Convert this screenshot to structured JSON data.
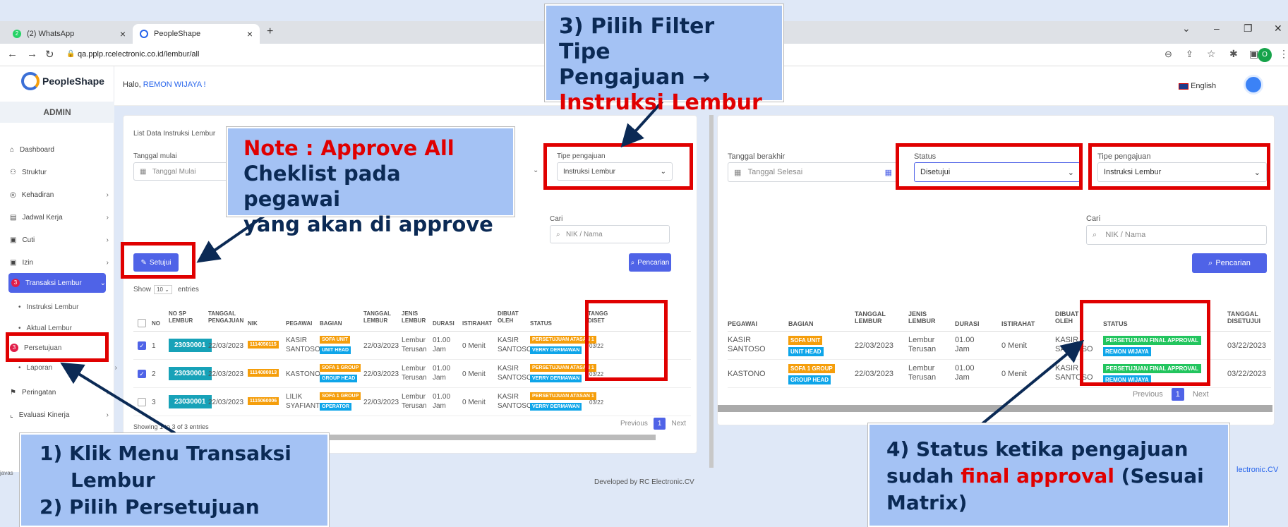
{
  "browser": {
    "tab1": "(2) WhatsApp",
    "tab2": "PeopleShape",
    "url": "qa.pplp.rcelectronic.co.id/lembur/all",
    "status_text": "javas"
  },
  "app": {
    "logo": "PeopleShape",
    "role": "ADMIN",
    "greeting_prefix": "Halo, ",
    "greeting_name": "REMON WIJAYA !",
    "language": "English",
    "footer": "Developed by RC Electronic.CV",
    "footer_right": "lectronic.CV"
  },
  "sidebar": {
    "items": [
      {
        "label": "Dashboard",
        "icon": "home-icon"
      },
      {
        "label": "Struktur",
        "icon": "org-icon"
      },
      {
        "label": "Kehadiran",
        "icon": "fingerprint-icon"
      },
      {
        "label": "Jadwal Kerja",
        "icon": "calendar-icon"
      },
      {
        "label": "Cuti",
        "icon": "clipboard-icon"
      },
      {
        "label": "Izin",
        "icon": "clipboard-icon"
      },
      {
        "label": "Transaksi Lembur",
        "icon": "clock-icon",
        "badge": "3"
      },
      {
        "label": "Instruksi Lembur"
      },
      {
        "label": "Aktual Lembur"
      },
      {
        "label": "Persetujuan",
        "badge": "3"
      },
      {
        "label": "Laporan"
      },
      {
        "label": "Peringatan",
        "icon": "flag-icon"
      },
      {
        "label": "Evaluasi Kinerja",
        "icon": "chart-icon"
      }
    ]
  },
  "left_panel": {
    "title": "List Data Instruksi Lembur",
    "start_date_label": "Tanggal mulai",
    "start_date_placeholder": "Tanggal Mulai",
    "type_label": "Tipe pengajuan",
    "type_value": "Instruksi Lembur",
    "search_label": "Cari",
    "search_placeholder": "NIK / Nama",
    "approve_button": "Setujui",
    "search_button": "Pencarian",
    "show_prefix": "Show",
    "show_value": "10",
    "show_suffix": "entries",
    "headers": [
      "NO",
      "NO SP LEMBUR",
      "TANGGAL PENGAJUAN",
      "NIK",
      "PEGAWAI",
      "BAGIAN",
      "TANGGAL LEMBUR",
      "JENIS LEMBUR",
      "DURASI",
      "ISTIRAHAT",
      "DIBUAT OLEH",
      "STATUS",
      "TANGG DISET"
    ],
    "rows": [
      {
        "checked": true,
        "no": "1",
        "sp": "23030001",
        "tgl": "22/03/2023",
        "nik": "1114050115",
        "pegawai": "KASIR SANTOSO",
        "bagian1": "SOFA UNIT",
        "bagian2": "UNIT HEAD",
        "tgl_lembur": "22/03/2023",
        "jenis": "Lembur Terusan",
        "durasi": "01.00 Jam",
        "istirahat": "0 Menit",
        "dibuat": "KASIR SANTOSO",
        "status1": "PERSETUJUAN ATASAN 1",
        "status2": "VERRY DERMAWAN",
        "tgl_set": "03/22"
      },
      {
        "checked": true,
        "no": "2",
        "sp": "23030001",
        "tgl": "22/03/2023",
        "nik": "1114080013",
        "pegawai": "KASTONO",
        "bagian1": "SOFA 1 GROUP",
        "bagian2": "GROUP HEAD",
        "tgl_lembur": "22/03/2023",
        "jenis": "Lembur Terusan",
        "durasi": "01.00 Jam",
        "istirahat": "0 Menit",
        "dibuat": "KASIR SANTOSO",
        "status1": "PERSETUJUAN ATASAN 1",
        "status2": "VERRY DERMAWAN",
        "tgl_set": "03/22"
      },
      {
        "checked": false,
        "no": "3",
        "sp": "23030001",
        "tgl": "22/03/2023",
        "nik": "1115060006",
        "pegawai": "LILIK SYAFIANTI",
        "bagian1": "SOFA 1 GROUP",
        "bagian2": "OPERATOR",
        "tgl_lembur": "22/03/2023",
        "jenis": "Lembur Terusan",
        "durasi": "01.00 Jam",
        "istirahat": "0 Menit",
        "dibuat": "KASIR SANTOSO",
        "status1": "PERSETUJUAN ATASAN 1",
        "status2": "VERRY DERMAWAN",
        "tgl_set": "03/22"
      }
    ],
    "showing": "Showing 1 to 3 of 3 entries",
    "prev": "Previous",
    "page": "1",
    "next": "Next"
  },
  "right_panel": {
    "end_date_label": "Tanggal berakhir",
    "end_date_placeholder": "Tanggal Selesai",
    "status_label": "Status",
    "status_value": "Disetujui",
    "type_label": "Tipe pengajuan",
    "type_value": "Instruksi Lembur",
    "search_label": "Cari",
    "search_placeholder": "NIK / Nama",
    "search_button": "Pencarian",
    "headers": [
      "PEGAWAI",
      "BAGIAN",
      "TANGGAL LEMBUR",
      "JENIS LEMBUR",
      "DURASI",
      "ISTIRAHAT",
      "DIBUAT OLEH",
      "STATUS",
      "TANGGAL DISETUJUI"
    ],
    "rows": [
      {
        "pegawai": "KASIR SANTOSO",
        "bagian1": "SOFA UNIT",
        "bagian2": "UNIT HEAD",
        "tgl": "22/03/2023",
        "jenis": "Lembur Terusan",
        "durasi": "01.00 Jam",
        "istirahat": "0 Menit",
        "dibuat": "KASIR SANTOSO",
        "status1": "PERSETUJUAN FINAL APPROVAL",
        "status2": "REMON WIJAYA",
        "tgl_set": "03/22/2023"
      },
      {
        "pegawai": "KASTONO",
        "bagian1": "SOFA 1 GROUP",
        "bagian2": "GROUP HEAD",
        "tgl": "22/03/2023",
        "jenis": "Lembur Terusan",
        "durasi": "01.00 Jam",
        "istirahat": "0 Menit",
        "dibuat": "KASIR SANTOSO",
        "status1": "PERSETUJUAN FINAL APPROVAL",
        "status2": "REMON WIJAYA",
        "tgl_set": "03/22/2023"
      }
    ],
    "prev": "Previous",
    "page": "1",
    "next": "Next"
  },
  "callouts": {
    "step3_line1": "3) Pilih Filter Tipe",
    "step3_line2": "Pengajuan →",
    "step3_line3": "Instruksi Lembur",
    "note_line1": "Note : Approve All",
    "note_line2": "Cheklist pada pegawai",
    "note_line3": "yang akan di approve",
    "step12_line1": "1)  Klik Menu Transaksi",
    "step12_line2": "Lembur",
    "step12_line3": "2)  Pilih Persetujuan",
    "step4_line1": "4) Status ketika pengajuan",
    "step4_line2a": "sudah ",
    "step4_line2b": "final approval",
    "step4_line2c": " (Sesuai",
    "step4_line3": "Matrix)"
  }
}
